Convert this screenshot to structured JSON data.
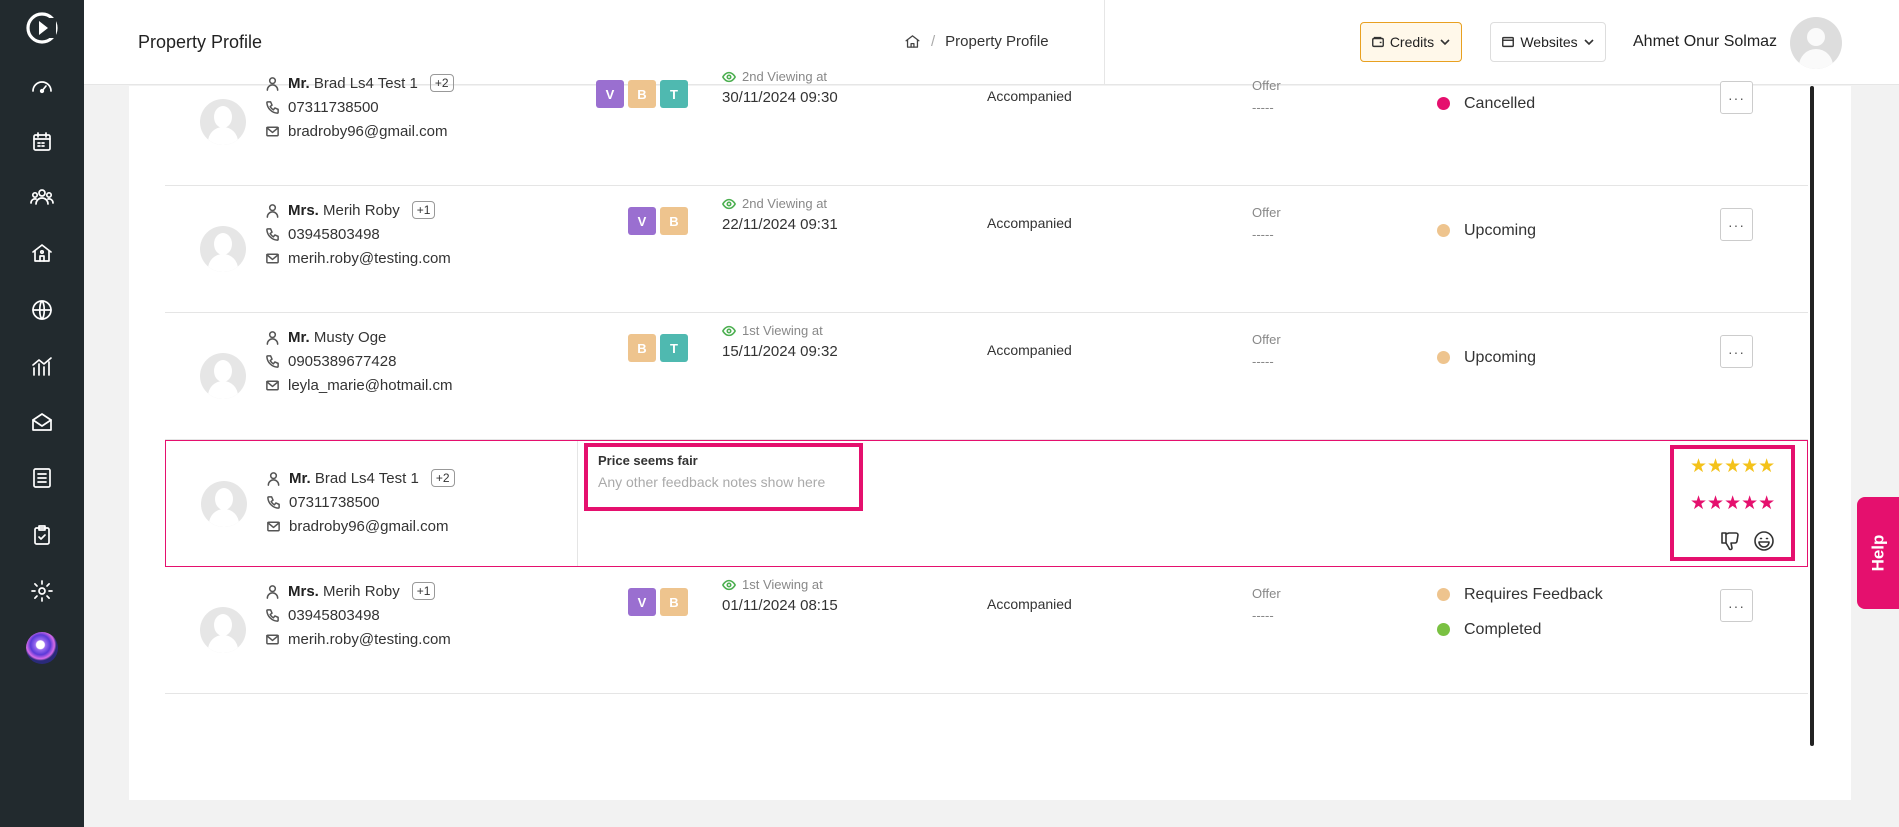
{
  "sidebar": {
    "items": [
      {
        "name": "sidebar-item-dashboard",
        "icon": "gauge-icon"
      },
      {
        "name": "sidebar-item-calendar",
        "icon": "calendar-icon"
      },
      {
        "name": "sidebar-item-contacts",
        "icon": "users-icon"
      },
      {
        "name": "sidebar-item-properties",
        "icon": "house-icon"
      },
      {
        "name": "sidebar-item-websites",
        "icon": "globe-icon"
      },
      {
        "name": "sidebar-item-reports",
        "icon": "chart-icon"
      },
      {
        "name": "sidebar-item-mail",
        "icon": "envelope-open-icon"
      },
      {
        "name": "sidebar-item-accounts",
        "icon": "ledger-icon"
      },
      {
        "name": "sidebar-item-tasks",
        "icon": "clipboard-check-icon"
      },
      {
        "name": "sidebar-item-settings",
        "icon": "gear-icon"
      }
    ]
  },
  "header": {
    "title": "Property Profile",
    "breadcrumb": {
      "current": "Property Profile",
      "separator": "/"
    },
    "credits_label": "Credits",
    "websites_label": "Websites",
    "user_name": "Ahmet Onur Solmaz"
  },
  "colors": {
    "accent": "#e5106e",
    "cancelled": "#e5106e",
    "upcoming": "#eec48e",
    "requires_feedback": "#eec48e",
    "completed": "#7ac142",
    "tag_v": "#9a6fd0",
    "tag_b": "#eec48e",
    "tag_t": "#4fb9b0"
  },
  "rows": [
    {
      "salutation": "Mr.",
      "name": "Brad Ls4 Test 1",
      "extra": "+2",
      "phone": "07311738500",
      "email": "bradroby96@gmail.com",
      "tags": [
        "V",
        "B",
        "T"
      ],
      "viewing_label": "2nd Viewing at",
      "viewing_date": "30/11/2024 09:30",
      "accompanied": "Accompanied",
      "offer_label": "Offer",
      "offer_value": "-----",
      "statuses": [
        {
          "label": "Cancelled",
          "color": "#e5106e"
        }
      ],
      "more": "···"
    },
    {
      "salutation": "Mrs.",
      "name": "Merih Roby",
      "extra": "+1",
      "phone": "03945803498",
      "email": "merih.roby@testing.com",
      "tags": [
        "V",
        "B"
      ],
      "viewing_label": "2nd Viewing at",
      "viewing_date": "22/11/2024 09:31",
      "accompanied": "Accompanied",
      "offer_label": "Offer",
      "offer_value": "-----",
      "statuses": [
        {
          "label": "Upcoming",
          "color": "#eec48e"
        }
      ],
      "more": "···"
    },
    {
      "salutation": "Mr.",
      "name": "Musty Oge",
      "extra": "",
      "phone": "0905389677428",
      "email": "leyla_marie@hotmail.cm",
      "tags": [
        "B",
        "T"
      ],
      "viewing_label": "1st Viewing at",
      "viewing_date": "15/11/2024 09:32",
      "accompanied": "Accompanied",
      "offer_label": "Offer",
      "offer_value": "-----",
      "statuses": [
        {
          "label": "Upcoming",
          "color": "#eec48e"
        }
      ],
      "more": "···"
    },
    {
      "salutation": "Mrs.",
      "name": "Merih Roby",
      "extra": "+1",
      "phone": "03945803498",
      "email": "merih.roby@testing.com",
      "tags": [
        "V",
        "B"
      ],
      "viewing_label": "1st Viewing at",
      "viewing_date": "01/11/2024 08:15",
      "accompanied": "Accompanied",
      "offer_label": "Offer",
      "offer_value": "-----",
      "statuses": [
        {
          "label": "Requires Feedback",
          "color": "#eec48e"
        },
        {
          "label": "Completed",
          "color": "#7ac142"
        }
      ],
      "more": "···"
    }
  ],
  "feedback_row": {
    "salutation": "Mr.",
    "name": "Brad Ls4 Test 1",
    "extra": "+2",
    "phone": "07311738500",
    "email": "bradroby96@gmail.com",
    "note_title": "Price seems fair",
    "note_body": "Any other feedback notes show here",
    "rating_yellow": 5,
    "rating_pink": 5,
    "reaction_icons": [
      "thumbs-down-icon",
      "smiley-icon"
    ]
  },
  "help_label": "Help"
}
